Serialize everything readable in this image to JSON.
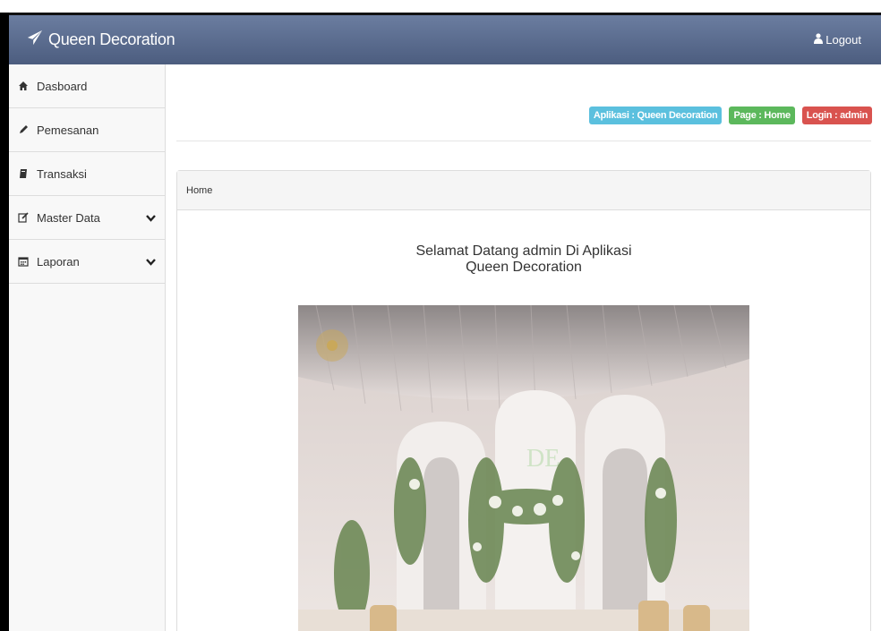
{
  "navbar": {
    "brand": "Queen Decoration",
    "logout_label": "Logout"
  },
  "sidebar": {
    "items": [
      {
        "label": "Dasboard",
        "icon": "home-icon"
      },
      {
        "label": "Pemesanan",
        "icon": "pencil-icon"
      },
      {
        "label": "Transaksi",
        "icon": "book-icon"
      },
      {
        "label": "Master Data",
        "icon": "edit-icon",
        "has_submenu": true
      },
      {
        "label": "Laporan",
        "icon": "calendar-icon",
        "has_submenu": true
      }
    ]
  },
  "header_labels": {
    "app": "Aplikasi : Queen Decoration",
    "page": "Page : Home",
    "login": "Login : admin"
  },
  "panel": {
    "heading": "Home",
    "welcome_line1": "Selamat Datang admin Di Aplikasi",
    "welcome_line2": "Queen Decoration"
  },
  "photo": {
    "monogram": "DE"
  },
  "colors": {
    "navbar": "#5a6b8e",
    "label_info": "#5bc0de",
    "label_success": "#5cb85c",
    "label_danger": "#d9534f"
  }
}
